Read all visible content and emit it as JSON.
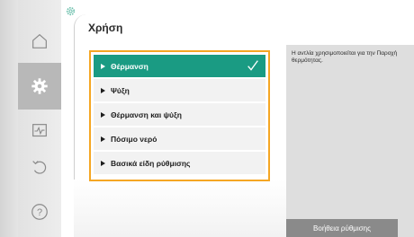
{
  "nav": {
    "items": [
      {
        "icon": "home-icon",
        "active": false
      },
      {
        "icon": "gear-icon",
        "active": true
      },
      {
        "icon": "monitor-pulse-icon",
        "active": false
      },
      {
        "icon": "undo-icon",
        "active": false
      },
      {
        "icon": "help-icon",
        "active": false
      }
    ]
  },
  "header": {
    "title": "Χρήση"
  },
  "menu": {
    "options": [
      {
        "label": "Θέρμανση",
        "selected": true
      },
      {
        "label": "Ψύξη",
        "selected": false
      },
      {
        "label": "Θέρμανση και ψύξη",
        "selected": false
      },
      {
        "label": "Πόσιμο νερό",
        "selected": false
      },
      {
        "label": "Βασικά είδη ρύθμισης",
        "selected": false
      }
    ]
  },
  "help": {
    "text": "Η αντλία χρησιμοποιείται για την Παροχή θερμότητας.",
    "button_label": "Βοήθεια ρύθμισης"
  },
  "colors": {
    "accent": "#1a9b83",
    "focus_frame": "#f5a623"
  }
}
